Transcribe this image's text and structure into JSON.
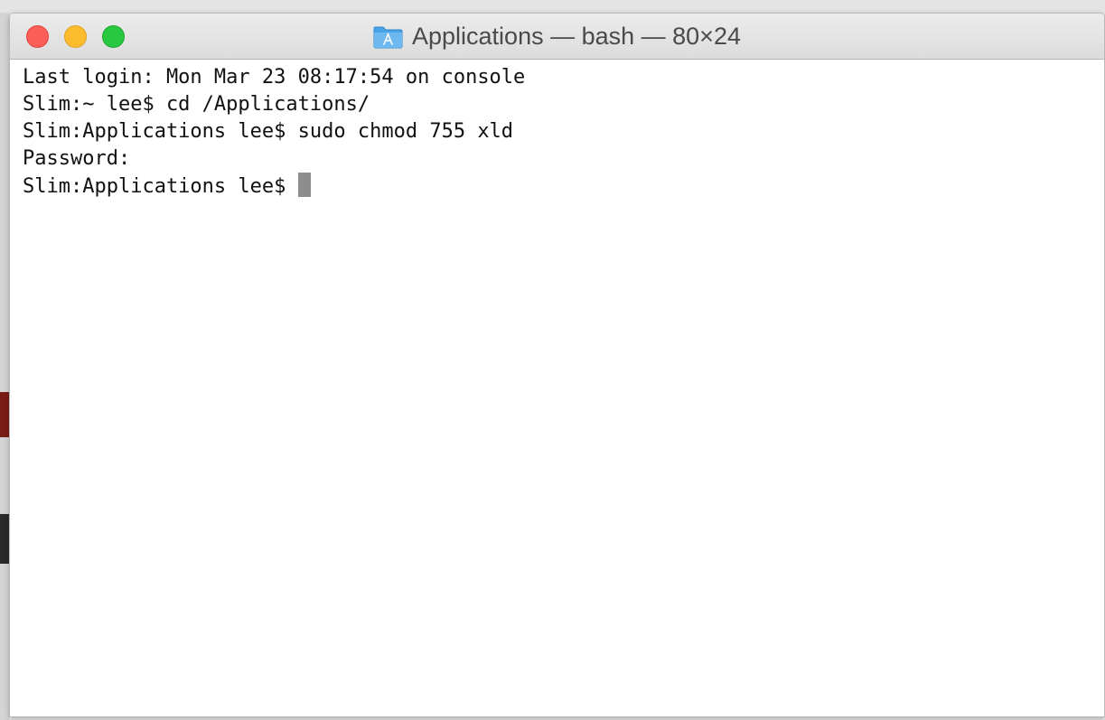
{
  "window": {
    "title": "Applications — bash — 80×24",
    "title_icon": "applications-folder-icon",
    "colors": {
      "close": "#fc5f57",
      "minimize": "#fdbc2e",
      "zoom": "#28c840",
      "folder": "#4aa3e6"
    }
  },
  "terminal": {
    "lines": [
      "Last login: Mon Mar 23 08:17:54 on console",
      "Slim:~ lee$ cd /Applications/",
      "Slim:Applications lee$ sudo chmod 755 xld",
      "Password:",
      "Slim:Applications lee$ "
    ],
    "cursor_color": "#8d8d8d"
  }
}
